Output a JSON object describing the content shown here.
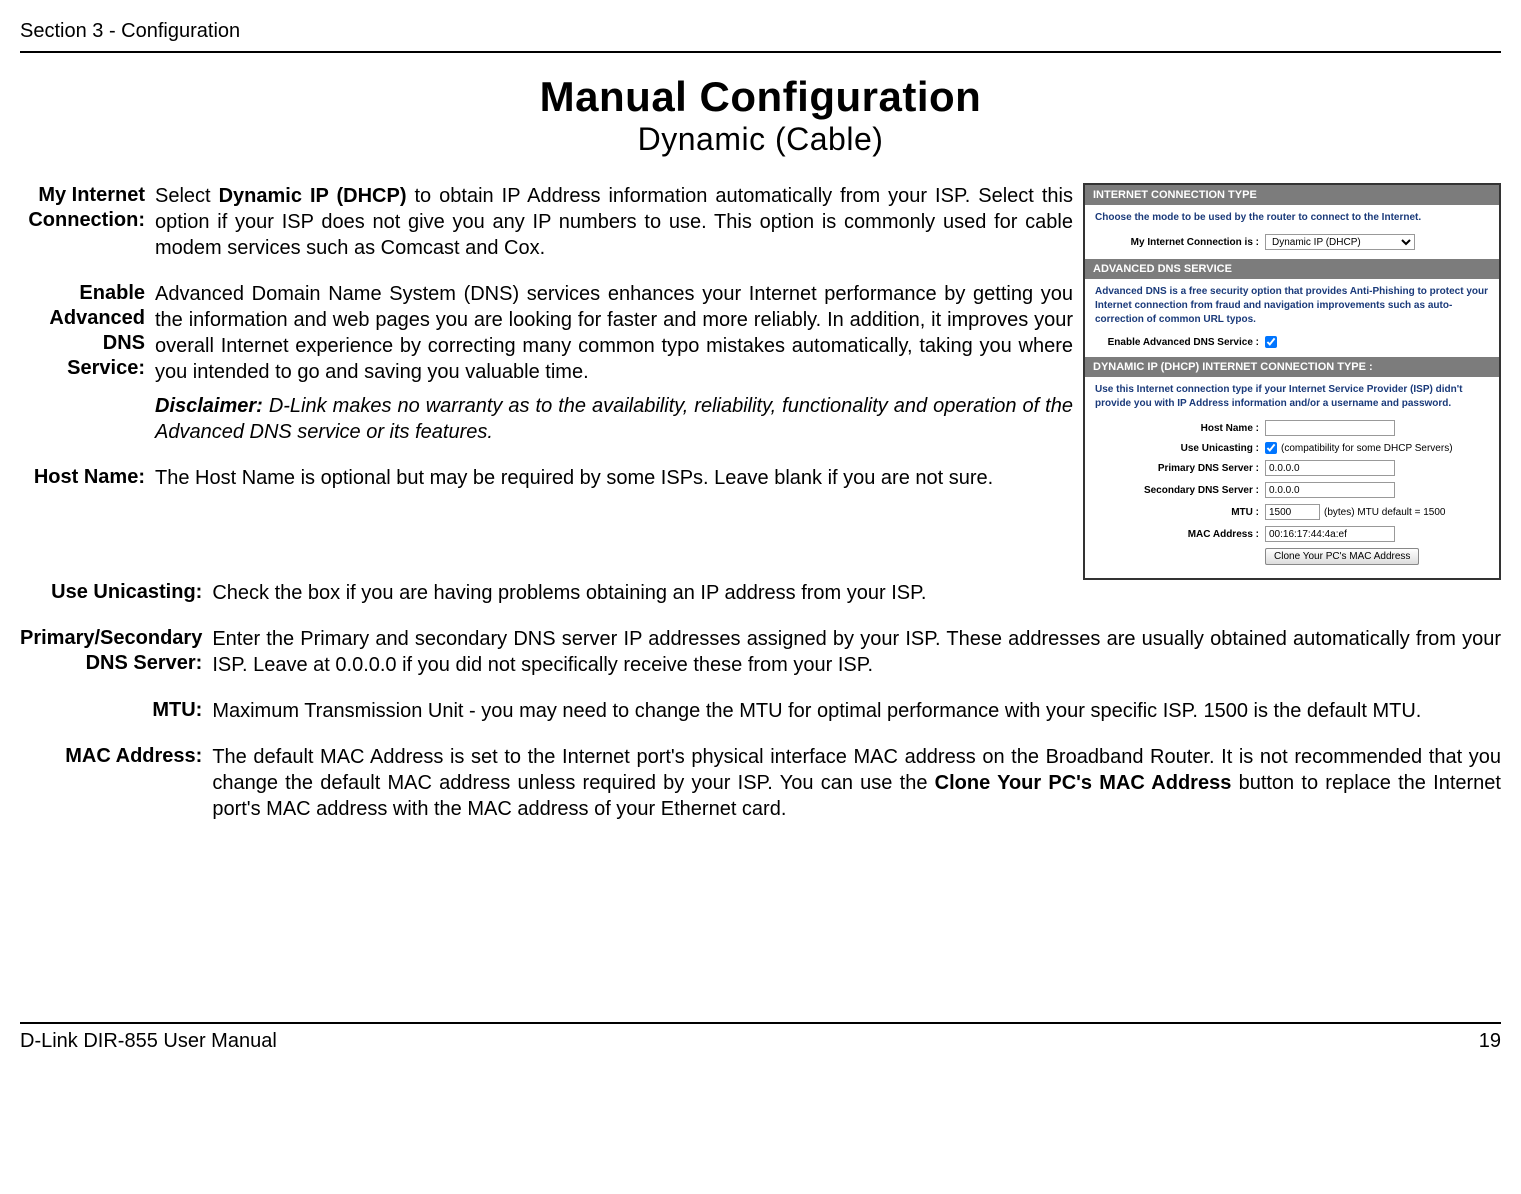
{
  "header": {
    "section": "Section 3 - Configuration"
  },
  "title": {
    "main": "Manual Configuration",
    "sub": "Dynamic (Cable)"
  },
  "rows": {
    "myInternet": {
      "label": "My Internet Connection:",
      "text_pre": "Select ",
      "text_bold": "Dynamic IP (DHCP)",
      "text_post": " to obtain IP Address information automatically from your ISP. Select this option if your ISP does not give you any IP numbers to use. This option is commonly used for cable modem services such as Comcast and Cox."
    },
    "enableAdv": {
      "label": "Enable Advanced DNS Service:",
      "text": "Advanced Domain Name System (DNS) services enhances your Internet performance by getting you the information and web pages you are looking for faster and more reliably.  In addition, it improves your overall Internet experience by correcting many common typo mistakes automatically, taking you where you intended to go and saving you valuable time.",
      "disclaimer_label": "Disclaimer:",
      "disclaimer_text": " D-Link makes no warranty as to the availability, reliability, functionality and operation of the Advanced DNS service or its features."
    },
    "hostName": {
      "label": "Host Name:",
      "text": "The Host Name is optional but may be required by some ISPs. Leave blank if you are not sure."
    },
    "useUnicasting": {
      "label": "Use Unicasting:",
      "text": "Check the box if you are having problems obtaining an IP address from your ISP."
    },
    "dns": {
      "label": "Primary/Secondary DNS Server:",
      "text": "Enter the Primary and secondary DNS server IP addresses assigned by your ISP. These addresses are usually obtained automatically from your ISP. Leave at 0.0.0.0 if you did not specifically receive these from your ISP."
    },
    "mtu": {
      "label": "MTU:",
      "text": "Maximum Transmission Unit - you may need to change the MTU for optimal performance with your specific ISP. 1500 is the default MTU."
    },
    "mac": {
      "label": "MAC Address:",
      "text_pre": "The default MAC Address is set to the Internet port's physical interface MAC address on the Broadband Router. It is not recommended that you change the default MAC address unless required by your ISP.  You can use the ",
      "text_bold": "Clone Your PC's MAC Address",
      "text_post": " button to replace the Internet port's MAC address with the MAC address of your Ethernet card."
    }
  },
  "panel": {
    "sec1_header": "INTERNET CONNECTION TYPE",
    "sec1_desc": "Choose the mode to be used by the router to connect to the Internet.",
    "sec1_label": "My Internet Connection is :",
    "sec1_value": "Dynamic IP (DHCP)",
    "sec2_header": "ADVANCED DNS SERVICE",
    "sec2_desc": "Advanced DNS is a free security option that provides Anti-Phishing to protect your Internet connection from fraud and navigation improvements such as auto-correction of common URL typos.",
    "sec2_label": "Enable Advanced DNS Service :",
    "sec3_header": "DYNAMIC IP (DHCP) INTERNET CONNECTION TYPE :",
    "sec3_desc": "Use this Internet connection type if your Internet Service Provider (ISP) didn't provide you with IP Address information and/or a username and password.",
    "host_label": "Host Name :",
    "host_value": "",
    "unicast_label": "Use Unicasting :",
    "unicast_aux": "(compatibility for some DHCP Servers)",
    "pdns_label": "Primary DNS Server :",
    "pdns_value": "0.0.0.0",
    "sdns_label": "Secondary DNS Server :",
    "sdns_value": "0.0.0.0",
    "mtu_label": "MTU :",
    "mtu_value": "1500",
    "mtu_aux": "(bytes) MTU default = 1500",
    "mac_label": "MAC Address :",
    "mac_value": "00:16:17:44:4a:ef",
    "clone_button": "Clone Your PC's MAC Address"
  },
  "footer": {
    "left": "D-Link DIR-855 User Manual",
    "right": "19"
  }
}
